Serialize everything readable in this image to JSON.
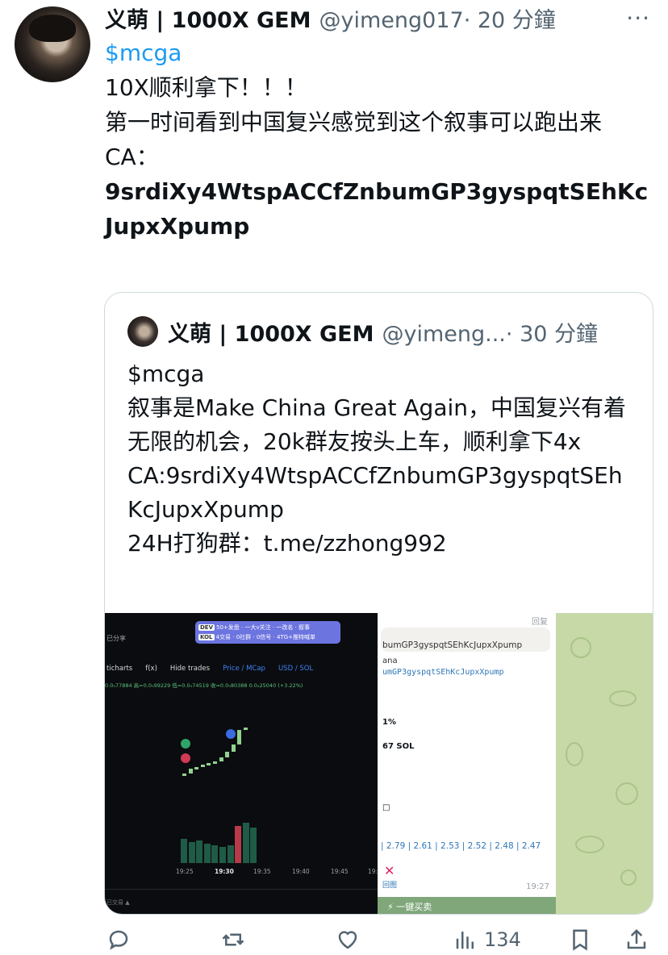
{
  "tweet": {
    "name": "义萌 | 1000X GEM",
    "handle": "@yimeng017",
    "time": "· 20 分鐘",
    "more": "···",
    "lines": [
      "$mcga",
      "10X顺利拿下！！！",
      "第一时间看到中国复兴感觉到这个叙事可以跑出来",
      "CA：",
      "9srdiXy4WtspACCfZnbumGP3gyspqtSEhKcJupxXpump"
    ]
  },
  "quote": {
    "name": "义萌 | 1000X GEM",
    "handle": "@yimeng...",
    "time": "· 30 分鐘",
    "lines": [
      "$mcga",
      "叙事是Make China Great Again，中国复兴有着无限的机会，20k群友按头上车，顺利拿下4x",
      "CA:9srdiXy4WtspACCfZnbumGP3gyspqtSEhKcJupxXpump",
      "24H打狗群：t.me/zzhong992"
    ],
    "media": {
      "chart": {
        "badge_row1": [
          "DEV",
          "50+发盘",
          "一大v关注",
          "一改名",
          "叙事"
        ],
        "badge_row2": [
          "KOL",
          "4交易",
          "0社群",
          "0信号",
          "4TG+推特喊单"
        ],
        "share": "已分享",
        "toolbar": [
          "ticharts",
          "f(x)",
          "Hide trades",
          "Price / MCap",
          "USD / SOL"
        ],
        "ohlc": "0.0₅77884 高=0.0₅99229 低=0.0₅74519 收=0.0₅80388 0.0₅25040 (+3.22%)",
        "xaxis": [
          "19:25",
          "19:30",
          "19:35",
          "19:40",
          "19:45",
          "19:"
        ],
        "footer": "已交易 ▲",
        "candles": [
          0.7451,
          0.77,
          0.78,
          0.79,
          0.8,
          0.81,
          0.83,
          0.86,
          0.9,
          0.98,
          0.99
        ],
        "volumes": [
          30,
          26,
          28,
          24,
          22,
          20,
          22,
          46,
          50,
          44
        ]
      },
      "message": {
        "reply": "回复",
        "ca_fragment": "bumGP3gyspqtSEhKcJupxXpump",
        "chain": "ana",
        "ca_mono": "umGP3gyspqtSEhKcJupxXpump",
        "pct": "1%",
        "sol": "67 SOL",
        "square": "□",
        "prices": "| 2.79 | 2.61 | 2.53 | 2.52 | 2.48 | 2.47",
        "cross": "✕",
        "back": "回图",
        "time": "19:27",
        "button": "⚡ 一键买卖"
      }
    }
  },
  "actions": {
    "reply_icon": "reply-icon",
    "retweet_icon": "retweet-icon",
    "like_icon": "like-icon",
    "views_icon": "views-icon",
    "views_count": "134",
    "bookmark_icon": "bookmark-icon",
    "share_icon": "share-icon"
  }
}
